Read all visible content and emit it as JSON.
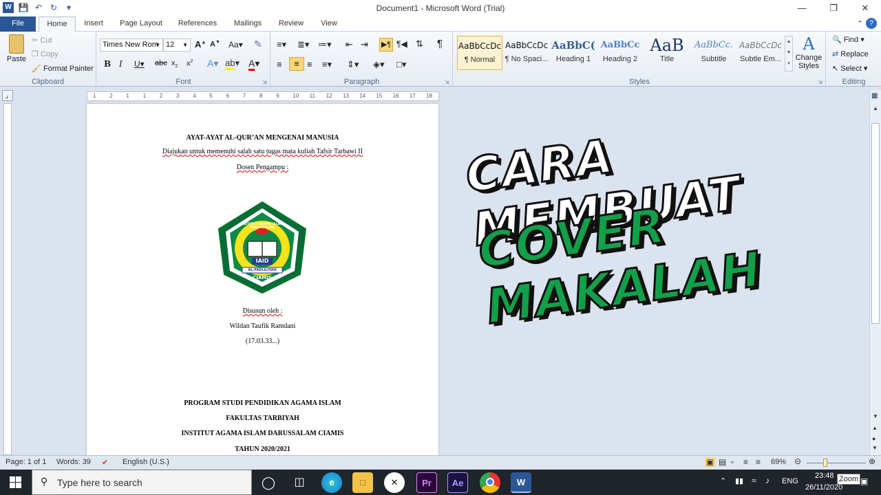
{
  "window": {
    "title": "Document1 - Microsoft Word (Trial)"
  },
  "tabs": [
    "File",
    "Home",
    "Insert",
    "Page Layout",
    "References",
    "Mailings",
    "Review",
    "View"
  ],
  "clipboard": {
    "paste": "Paste",
    "cut": "Cut",
    "copy": "Copy",
    "format_painter": "Format Painter",
    "label": "Clipboard"
  },
  "font": {
    "name": "Times New Rom",
    "size": "12",
    "label": "Font",
    "grow": "A",
    "case": "Aa"
  },
  "paragraph": {
    "label": "Paragraph"
  },
  "styles": {
    "items": [
      {
        "sample": "AaBbCcDc",
        "name": "¶ Normal"
      },
      {
        "sample": "AaBbCcDc",
        "name": "¶ No Spaci..."
      },
      {
        "sample": "AaBbC(",
        "name": "Heading 1"
      },
      {
        "sample": "AaBbCc",
        "name": "Heading 2"
      },
      {
        "sample": "AaB",
        "name": "Title"
      },
      {
        "sample": "AaBbCc.",
        "name": "Subtitle"
      },
      {
        "sample": "AaBbCcDc",
        "name": "Subtle Em..."
      }
    ],
    "change": "Change Styles",
    "label": "Styles"
  },
  "editing": {
    "find": "Find",
    "replace": "Replace",
    "select": "Select",
    "label": "Editing"
  },
  "document": {
    "title": "AYAT-AYAT AL-QUR’AN MENGENAI MANUSIA",
    "subtitle": "Diajukan untuk memenuhi salah satu tugas mata kuliah Tafsir Tarbawi II",
    "lecturer": "Dosen Pengampu :",
    "logo_top": "INSTITUT AGAMA ISLAM DARUSSALAM",
    "logo_iaid": "IAID",
    "logo_ribbon": "AL-FADLILIYAH",
    "logo_bottom": "CIAMIS",
    "by_label": "Disusun oleh :",
    "author": "Wildan Taufik Ramdani",
    "id": "(17.03.33...)",
    "program": "PROGRAM STUDI PENDIDIKAN AGAMA ISLAM",
    "faculty": "FAKULTAS TARBIYAH",
    "institute": "INSTITUT AGAMA ISLAM DARUSSALAM CIAMIS",
    "year": "TAHUN 2020/2021"
  },
  "ruler_numbers": [
    "1",
    "2",
    "1",
    "1",
    "2",
    "3",
    "4",
    "5",
    "6",
    "7",
    "8",
    "9",
    "10",
    "11",
    "12",
    "13",
    "14",
    "15",
    "16",
    "17",
    "18"
  ],
  "overlay": {
    "line1": "CARA MEMBUAT",
    "line2": "COVER MAKALAH",
    "color1": "#ffffff",
    "color2": "#12a04a"
  },
  "status": {
    "page": "Page: 1 of 1",
    "words": "Words: 39",
    "language": "English (U.S.)",
    "zoom": "69%",
    "zoom_tip": "Zoom"
  },
  "taskbar": {
    "search_placeholder": "Type here to search",
    "time": "23:48",
    "date": "26/11/2020",
    "lang": "ENG"
  }
}
